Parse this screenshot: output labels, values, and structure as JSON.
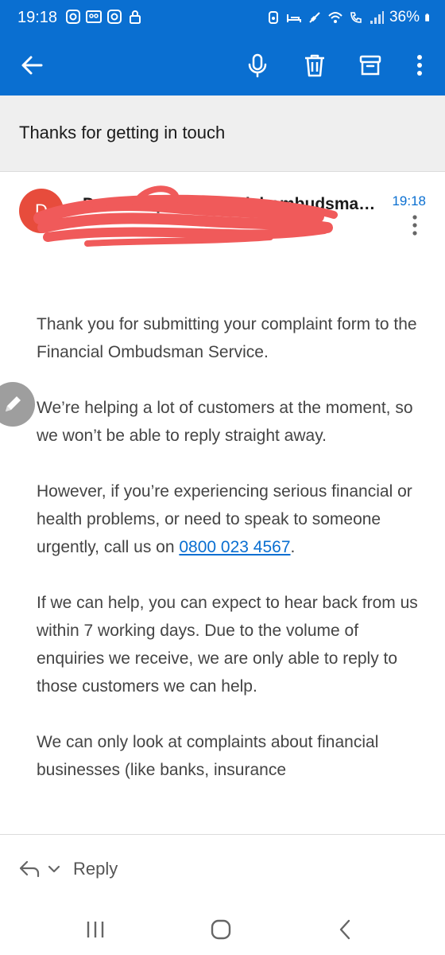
{
  "status_bar": {
    "time": "19:18",
    "battery": "36%",
    "left_icons": [
      "instagram-icon",
      "voicemail-icon",
      "instagram-icon",
      "lock-icon"
    ],
    "right_icons": [
      "alarm-icon",
      "sleep-icon",
      "mute-icon",
      "wifi-icon",
      "wifi-calling-icon",
      "signal-icon",
      "battery-icon"
    ]
  },
  "toolbar": {
    "back_icon": "back-arrow-icon",
    "mic_icon": "microphone-icon",
    "delete_icon": "trash-icon",
    "archive_icon": "archive-icon",
    "more_icon": "more-vertical-icon"
  },
  "email": {
    "subject": "Thanks for getting in touch",
    "sender": {
      "avatar_letter": "D",
      "address": "Do not reply@financial-ombudsman-service.org.uk",
      "time": "19:18"
    },
    "body": {
      "p1": "Thank you for submitting your complaint form to the Financial Ombudsman Service.",
      "p2": "We’re helping a lot of customers at the moment, so we won’t be able to reply straight away.",
      "p3_before": "However, if you’re experiencing serious financial or health problems, or need to speak to someone urgently, call us on ",
      "p3_phone": "0800 023 4567",
      "p3_after": ".",
      "p4": "If we can help, you can expect to hear back from us within 7 working days. Due to the volume of enquiries we receive, we are only able to reply to those customers we can help.",
      "p5": "We can only look at complaints about financial businesses (like banks, insurance"
    }
  },
  "reply_bar": {
    "label": "Reply"
  },
  "colors": {
    "brand_blue": "#0a6fd1",
    "avatar_red": "#e74c3c",
    "redaction_red": "#f05a5a",
    "link": "#0a6fd1"
  }
}
